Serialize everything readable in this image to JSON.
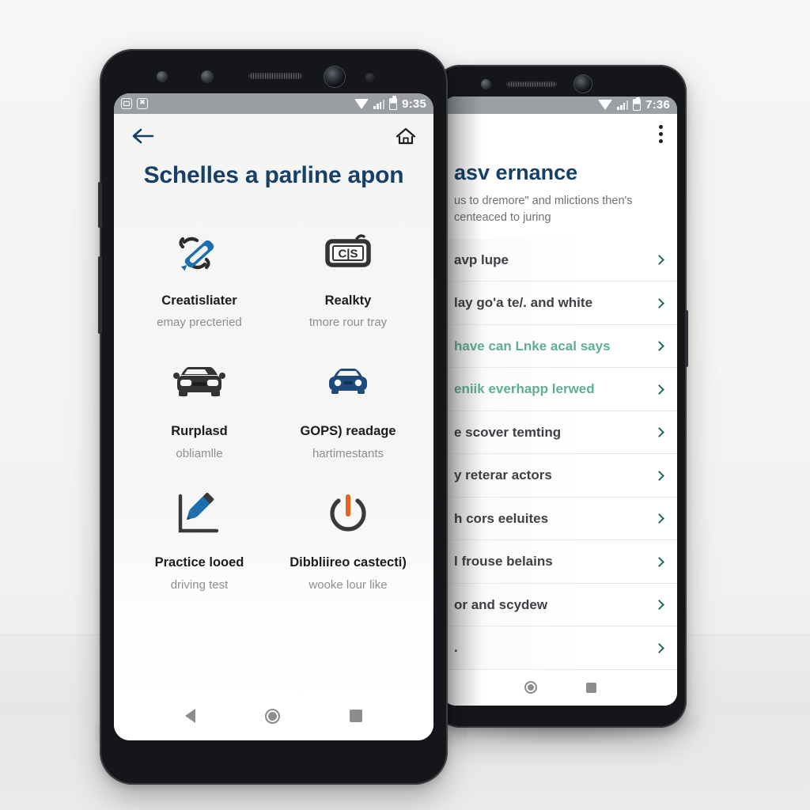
{
  "scene": {
    "background_color": "#f3f3f2",
    "surface_color": "#e9e9e8"
  },
  "left_phone": {
    "status_bar": {
      "time": "9:35",
      "notification_icons": [
        "message-icon",
        "sync-error-icon"
      ],
      "system_icons": [
        "wifi-icon",
        "signal-icon",
        "battery-icon"
      ],
      "background_color": "#9a9ea3"
    },
    "app_bar": {
      "back_icon": "back-arrow-icon",
      "home_icon": "home-icon"
    },
    "hero_title": "Schelles a parline apon",
    "hero_title_color": "#174068",
    "tiles": [
      {
        "icon": "wrench-screwdriver-icon",
        "title": "Creatisliater",
        "subtitle": "emay precteried"
      },
      {
        "icon": "license-plate-cis-icon",
        "title": "Realkty",
        "subtitle": "tmore rour tray"
      },
      {
        "icon": "car-front-dark-icon",
        "title": "Rurplasd",
        "subtitle": "obliamlle"
      },
      {
        "icon": "car-front-blue-icon",
        "title": "GOPS) readage",
        "subtitle": "hartimestants"
      },
      {
        "icon": "pen-chart-icon",
        "title": "Practice looed",
        "subtitle": "driving test"
      },
      {
        "icon": "power-button-icon",
        "title": "Dibbliireo castecti)",
        "subtitle": "wooke lour like"
      }
    ],
    "nav_bar": {
      "back": "nav-back-icon",
      "home": "nav-home-icon",
      "recents": "nav-recents-icon"
    }
  },
  "right_phone": {
    "status_bar": {
      "time": "7:36",
      "system_icons": [
        "wifi-icon",
        "signal-icon",
        "battery-icon"
      ],
      "background_color": "#9ba0a5"
    },
    "app_bar": {
      "overflow_icon": "kebab-menu-icon"
    },
    "title": "asv ernance",
    "title_color": "#174068",
    "subtitle": "us to dremore\" and mlictions then's centeaced to juring",
    "accent_color": "#5fae93",
    "chevron_color": "#1f6b52",
    "list_items": [
      {
        "label": "avp lupe",
        "accent": false,
        "chevron": "chevron-right-icon"
      },
      {
        "label": "lay go'a te/. and white",
        "accent": false,
        "chevron": "chevron-right-icon"
      },
      {
        "label": "have can Lnke acal says",
        "accent": true,
        "chevron": "chevron-right-icon"
      },
      {
        "label": "eniik everhapp lerwed",
        "accent": true,
        "chevron": "chevron-right-icon"
      },
      {
        "label": "e scover temting",
        "accent": false,
        "chevron": "chevron-right-icon"
      },
      {
        "label": "y reterar actors",
        "accent": false,
        "chevron": "chevron-right-icon"
      },
      {
        "label": "h cors eeluites",
        "accent": false,
        "chevron": "chevron-right-icon"
      },
      {
        "label": "l frouse belains",
        "accent": false,
        "chevron": "chevron-right-icon"
      },
      {
        "label": "or and scydew",
        "accent": false,
        "chevron": "chevron-right-icon"
      },
      {
        "label": ".",
        "accent": false,
        "chevron": "chevron-right-icon"
      }
    ],
    "nav_bar": {
      "home": "nav-home-icon",
      "recents": "nav-recents-icon"
    }
  }
}
